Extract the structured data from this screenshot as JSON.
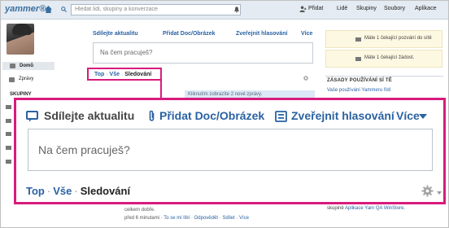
{
  "app": {
    "logo": "yammer®"
  },
  "topbar": {
    "search_placeholder": "Hledat lidi, skupiny a konverzace",
    "add_label": "Přidat",
    "people_label": "Lidé",
    "groups_label": "Skupiny",
    "files_label": "Soubory",
    "apps_label": "Aplikace"
  },
  "sidebar": {
    "home_label": "Domů",
    "messages_label": "Zprávy",
    "groups_heading": "SKUPINY"
  },
  "composer_small": {
    "tabs": [
      "Sdílejte aktualitu",
      "Přidat Doc/Obrázek",
      "Zveřejnit hlasování",
      "Více"
    ],
    "placeholder": "Na čem pracuješ?"
  },
  "filter_small": {
    "top": "Top",
    "all": "Vše",
    "following": "Sledování"
  },
  "banner": "Kliknutím zobrazíte 2 nové zprávy.",
  "right_panel": {
    "invite_notice": "Máte 1 čekající pozvání do sítě",
    "request_notice": "Máte 1 čekající žádost.",
    "policy_title": "ZÁSADY POUŽÍVÁNÍ SÍ TĚ",
    "policy_text": "Vaše používání Yammeru řídí",
    "bottom_text": "skupině",
    "bottom_link": "Aplikace Yam QA WinStore."
  },
  "feed": {
    "line1": "celkem dobře.",
    "time": "před 6 minutami",
    "like": "To se mi líbí",
    "reply": "Odpovědět",
    "share": "Sdílet",
    "more": "Více"
  },
  "zoom": {
    "share_update": "Sdílejte aktualitu",
    "add_doc": "Přidat Doc/Obrázek",
    "poll": "Zveřejnit hlasování",
    "more": "Více",
    "placeholder": "Na čem pracuješ?",
    "filter_top": "Top",
    "filter_all": "Vše",
    "filter_following": "Sledování"
  },
  "colors": {
    "highlight": "#d81b7d",
    "link": "#2a62a2",
    "topbar": "#e4ebf2"
  }
}
